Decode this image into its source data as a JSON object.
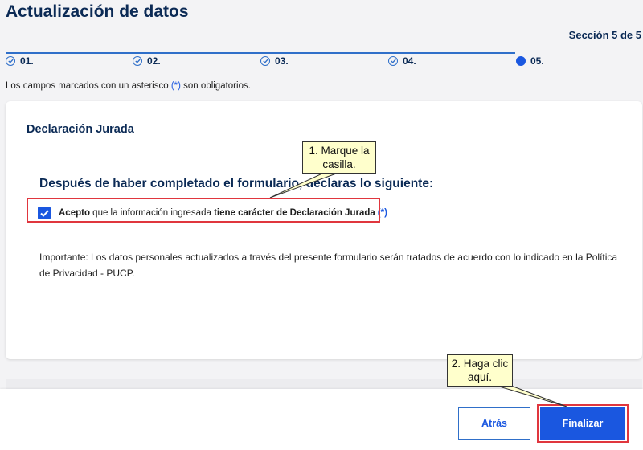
{
  "page": {
    "title": "Actualización de datos",
    "section_count": "Sección 5 de 5"
  },
  "stepper": {
    "steps": [
      {
        "label": "01.",
        "state": "completed"
      },
      {
        "label": "02.",
        "state": "completed"
      },
      {
        "label": "03.",
        "state": "completed"
      },
      {
        "label": "04.",
        "state": "completed"
      },
      {
        "label": "05.",
        "state": "current"
      }
    ]
  },
  "required_note": {
    "before": "Los campos marcados con un asterisco ",
    "asterisk": "(*)",
    "after": " son obligatorios."
  },
  "card": {
    "title": "Declaración Jurada",
    "heading": "Después de haber completado el formulario, declaras lo siguiente:",
    "consent": {
      "checked": true,
      "bold_start": "Acepto",
      "middle": " que la información ingresada ",
      "bold_end": "tiene carácter de Declaración Jurada",
      "asterisk": "(*)"
    },
    "important_text": "Importante: Los datos personales actualizados a través del presente formulario serán tratados de acuerdo con lo indicado en la Política de Privacidad - PUCP."
  },
  "footer": {
    "back_label": "Atrás",
    "finish_label": "Finalizar"
  },
  "callouts": {
    "step1": "1. Marque la casilla.",
    "step2": "2. Haga clic aquí."
  },
  "colors": {
    "brand_navy": "#0b2a55",
    "accent_blue": "#1a57e0",
    "highlight_red": "#e0363e",
    "callout_yellow": "#ffffcc"
  }
}
